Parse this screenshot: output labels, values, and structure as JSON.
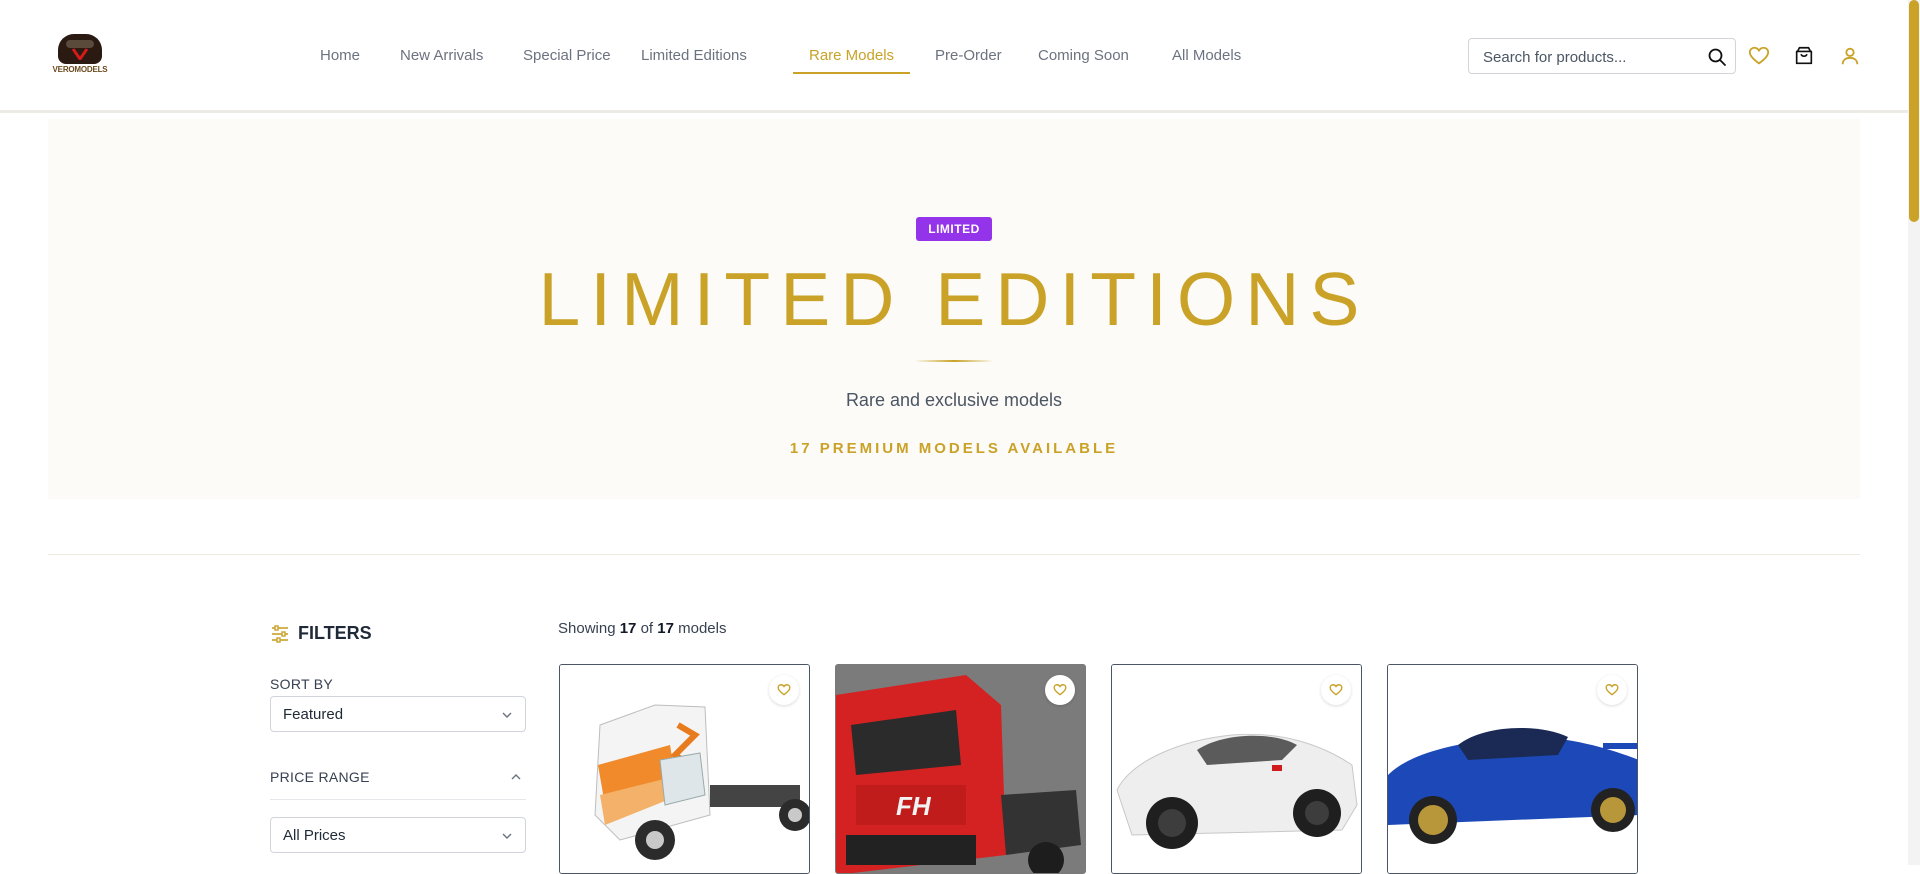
{
  "brand": {
    "logo_text": "VEROMODELS"
  },
  "nav": {
    "items": [
      {
        "label": "Home"
      },
      {
        "label": "New Arrivals"
      },
      {
        "label": "Special Price"
      },
      {
        "label": "Limited Editions"
      },
      {
        "label": "Rare Models",
        "active": true
      },
      {
        "label": "Pre-Order"
      },
      {
        "label": "Coming Soon"
      },
      {
        "label": "All Models"
      }
    ]
  },
  "search": {
    "placeholder": "Search for products...",
    "value": ""
  },
  "header_icons": [
    "search-icon",
    "heart-icon",
    "shopping-bag-icon",
    "user-icon"
  ],
  "hero": {
    "badge": "LIMITED",
    "title": "LIMITED EDITIONS",
    "subtitle": "Rare and exclusive models",
    "count_text": "17 PREMIUM MODELS AVAILABLE"
  },
  "filters": {
    "title": "FILTERS",
    "sort_label": "SORT BY",
    "sort_value": "Featured",
    "price_label": "PRICE RANGE",
    "price_value": "All Prices"
  },
  "results": {
    "prefix": "Showing",
    "shown": "17",
    "of": "of",
    "total": "17",
    "suffix": "models"
  },
  "products": [
    {
      "icon": "truck-white-orange-image"
    },
    {
      "icon": "truck-red-image"
    },
    {
      "icon": "white-sports-car-image"
    },
    {
      "icon": "blue-rally-car-image"
    }
  ],
  "colors": {
    "accent_gold": "#c9a227",
    "badge_purple": "#9333ea",
    "hero_bg": "#fcfbf7"
  }
}
